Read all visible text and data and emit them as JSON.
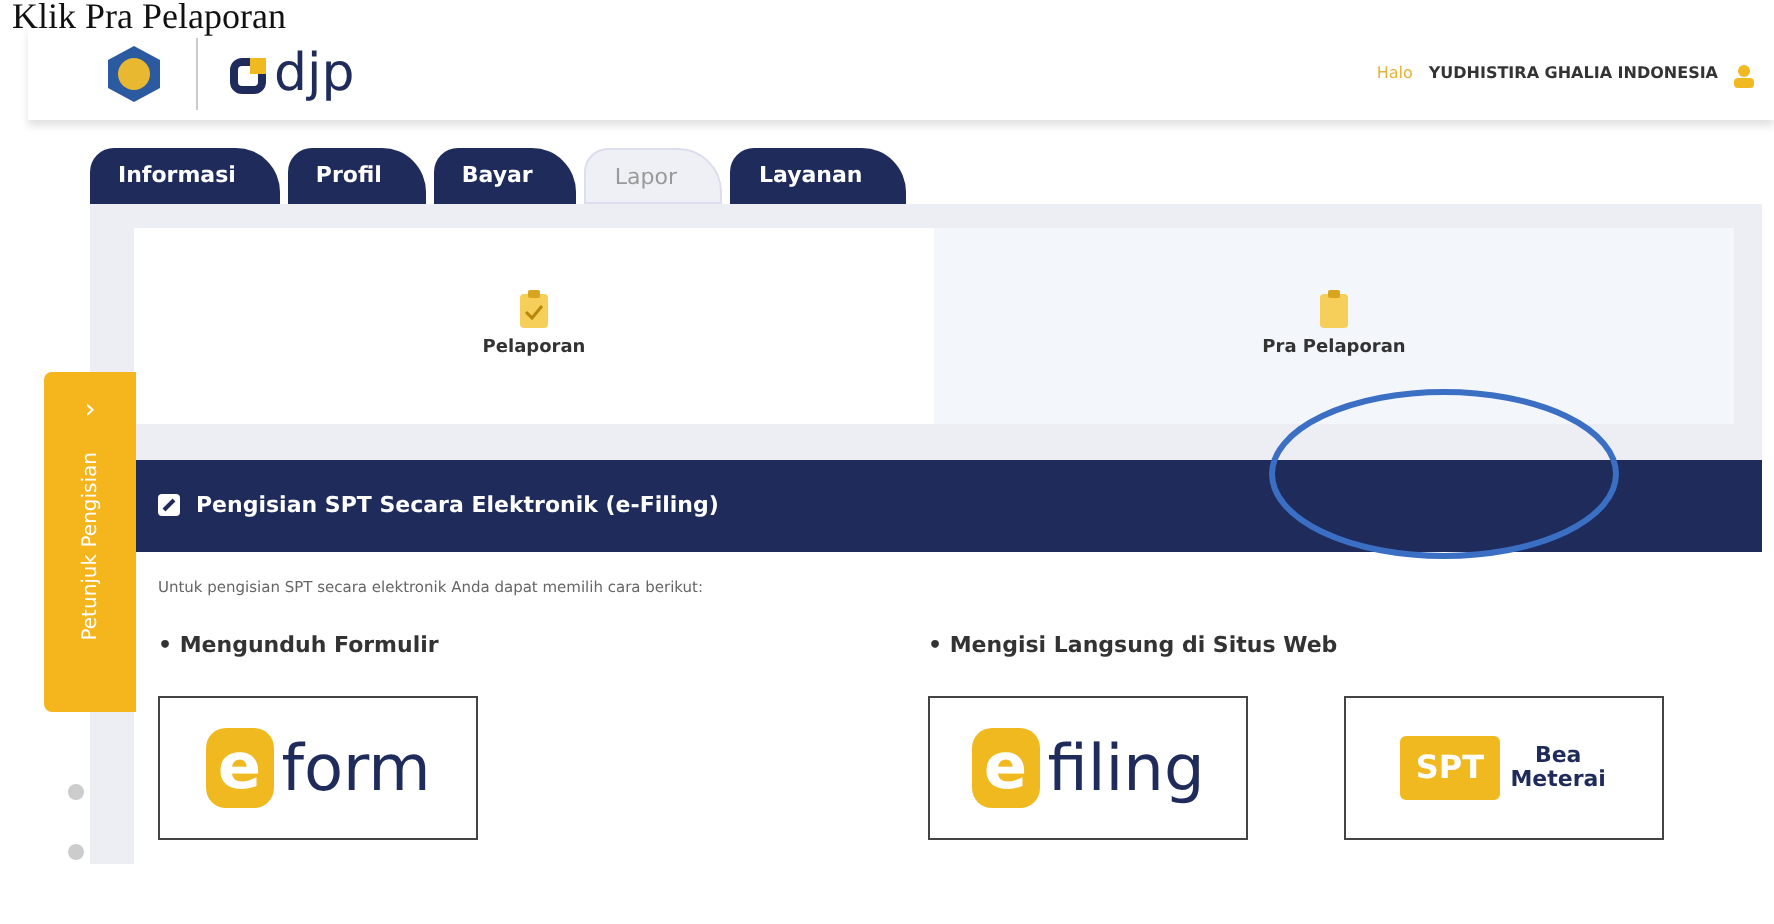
{
  "caption": "Klik Pra Pelaporan",
  "header": {
    "logo_text": "djp",
    "greeting": "Halo",
    "user": "YUDHISTIRA GHALIA INDONESIA"
  },
  "tabs": [
    {
      "label": "Informasi",
      "selected": false
    },
    {
      "label": "Profil",
      "selected": false
    },
    {
      "label": "Bayar",
      "selected": false
    },
    {
      "label": "Lapor",
      "selected": true
    },
    {
      "label": "Layanan",
      "selected": false
    }
  ],
  "side_tab": {
    "label": "Petunjuk Pengisian",
    "arrow": "›"
  },
  "menu_cards": [
    {
      "label": "Pelaporan",
      "selected": true
    },
    {
      "label": "Pra Pelaporan",
      "selected": false
    }
  ],
  "panel": {
    "title": "Pengisian SPT Secara Elektronik (e-Filing)",
    "intro": "Untuk pengisian SPT secara elektronik Anda dapat memilih cara berikut:",
    "sections": [
      {
        "heading": "• Mengunduh Formulir",
        "options": [
          {
            "kind": "e",
            "mark": "e",
            "text": "form"
          }
        ]
      },
      {
        "heading": "• Mengisi Langsung di Situs Web",
        "options": [
          {
            "kind": "e",
            "mark": "e",
            "text": "filing"
          },
          {
            "kind": "badge",
            "mark": "SPT",
            "text": "Bea Meterai"
          }
        ]
      }
    ]
  }
}
